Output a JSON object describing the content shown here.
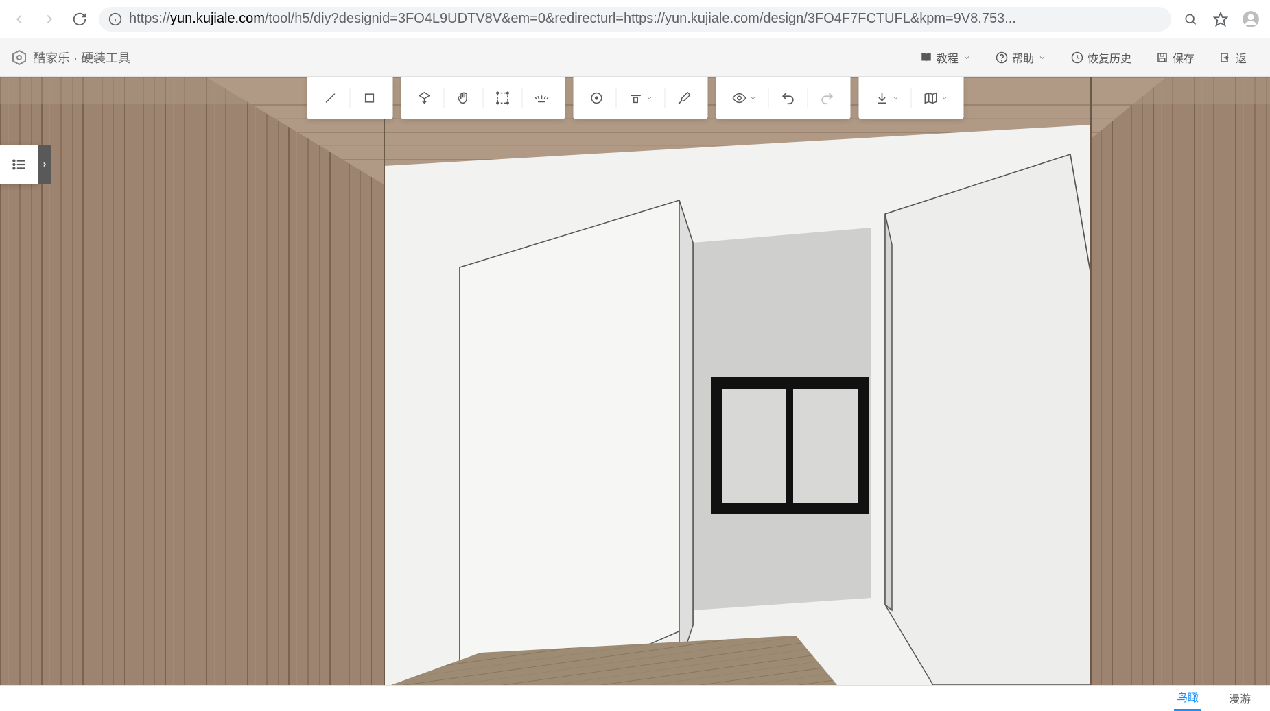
{
  "browser": {
    "url_protocol": "https://",
    "url_domain": "yun.kujiale.com",
    "url_path": "/tool/h5/diy?designid=3FO4L9UDTV8V&em=0&redirecturl=https://yun.kujiale.com/design/3FO4F7FCTUFL&kpm=9V8.753..."
  },
  "header": {
    "app_title": "酷家乐 · 硬装工具",
    "tutorial": "教程",
    "help": "帮助",
    "restore": "恢复历史",
    "save": "保存",
    "back": "返"
  },
  "toolbar": {
    "groups": [
      {
        "tools": [
          "line",
          "rect"
        ]
      },
      {
        "tools": [
          "extrude",
          "rotate",
          "select-area",
          "light"
        ]
      },
      {
        "tools": [
          "circle-target",
          "align-dropdown",
          "brush"
        ]
      },
      {
        "tools": [
          "eye-dropdown",
          "undo",
          "redo"
        ]
      },
      {
        "tools": [
          "download-dropdown",
          "map-dropdown"
        ]
      }
    ]
  },
  "bottom": {
    "bird_view": "鸟瞰",
    "roam": "漫游"
  }
}
